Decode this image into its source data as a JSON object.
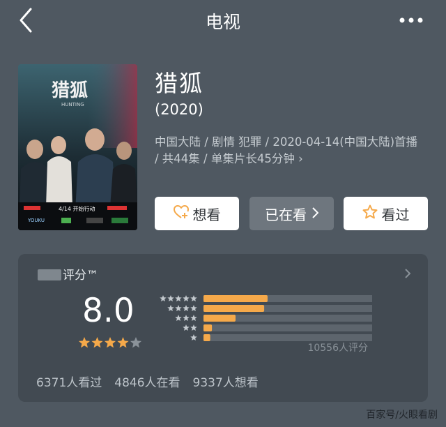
{
  "header": {
    "title": "电视",
    "back_icon": "chevron-left-icon",
    "more_icon": "more-dots-icon"
  },
  "show": {
    "title": "猎狐",
    "year": "(2020)",
    "info": "中国大陆 / 剧情 犯罪 / 2020-04-14(中国大陆)首播 / 共44集 / 单集片长45分钟",
    "poster": {
      "title_text": "猎狐",
      "subtitle_text": "HUNTING",
      "date_text": "4/14 开始行动",
      "logo_text": "YOUKU"
    }
  },
  "actions": {
    "want_label": "想看",
    "want_icon": "heart-plus-icon",
    "watching_label": "已在看",
    "watched_label": "看过",
    "watched_icon": "star-outline-icon"
  },
  "rating": {
    "label": "评分™",
    "score": "8.0",
    "stars": 4,
    "stars_max": 5,
    "distribution": [
      {
        "stars": 5,
        "fraction": 0.38
      },
      {
        "stars": 4,
        "fraction": 0.36
      },
      {
        "stars": 3,
        "fraction": 0.19
      },
      {
        "stars": 2,
        "fraction": 0.05
      },
      {
        "stars": 1,
        "fraction": 0.04
      }
    ],
    "count_text": "10556人评分",
    "bar_color": "#f5a94a",
    "track_color": "#5d656d"
  },
  "stats": {
    "watched": "6371人看过",
    "watching": "4846人在看",
    "want": "9337人想看"
  },
  "watermark": "百家号/火眼看剧"
}
